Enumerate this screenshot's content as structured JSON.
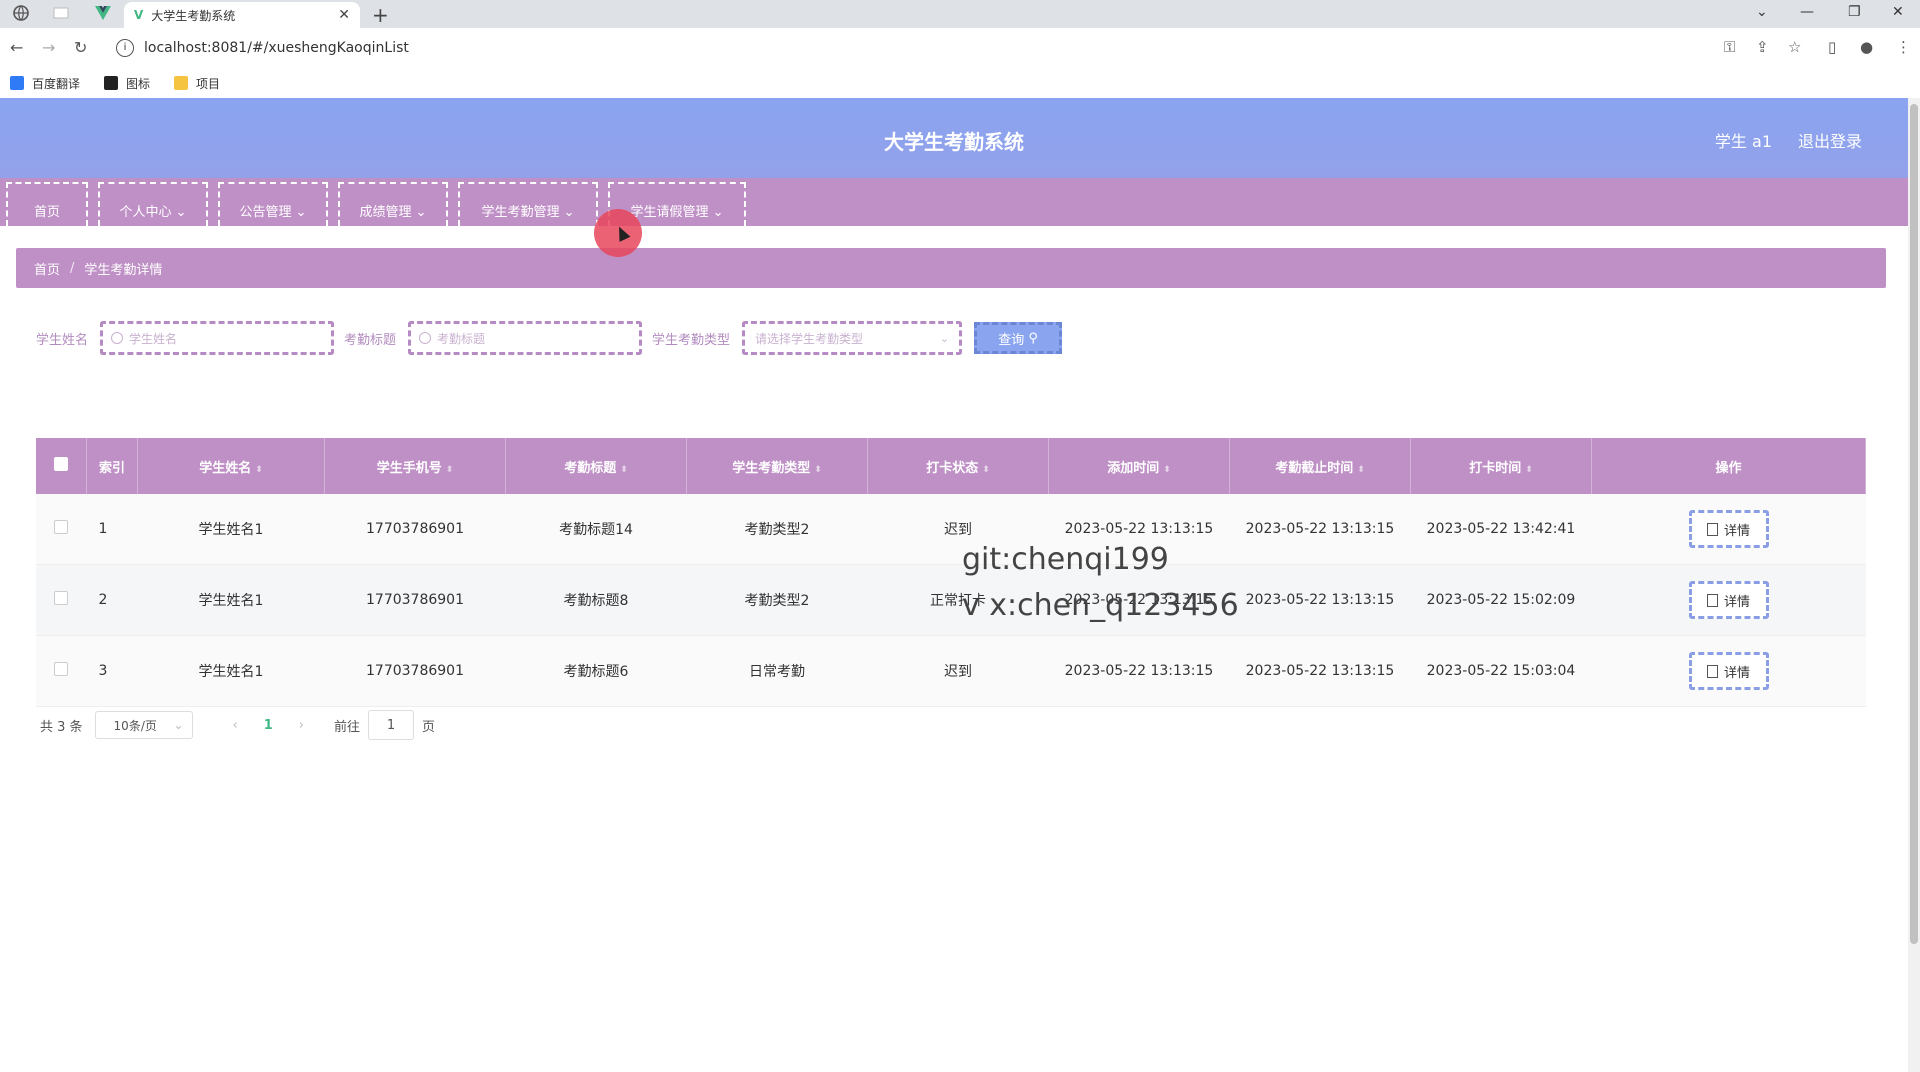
{
  "browser": {
    "tab_title": "大学生考勤系统",
    "url": "localhost:8081/#/xueshengKaoqinList",
    "bookmarks": [
      "百度翻译",
      "图标",
      "项目"
    ]
  },
  "app": {
    "title": "大学生考勤系统",
    "user": "学生 a1",
    "logout": "退出登录"
  },
  "menu": [
    "首页",
    "个人中心",
    "公告管理",
    "成绩管理",
    "学生考勤管理",
    "学生请假管理"
  ],
  "breadcrumb": [
    "首页",
    "学生考勤详情"
  ],
  "search": {
    "name_label": "学生姓名",
    "name_placeholder": "学生姓名",
    "title_label": "考勤标题",
    "title_placeholder": "考勤标题",
    "type_label": "学生考勤类型",
    "type_placeholder": "请选择学生考勤类型",
    "query_label": "查询"
  },
  "table": {
    "columns": [
      "索引",
      "学生姓名",
      "学生手机号",
      "考勤标题",
      "学生考勤类型",
      "打卡状态",
      "添加时间",
      "考勤截止时间",
      "打卡时间",
      "操作"
    ],
    "rows": [
      [
        "1",
        "学生姓名1",
        "17703786901",
        "考勤标题14",
        "考勤类型2",
        "迟到",
        "2023-05-22 13:13:15",
        "2023-05-22 13:13:15",
        "2023-05-22 13:42:41"
      ],
      [
        "2",
        "学生姓名1",
        "17703786901",
        "考勤标题8",
        "考勤类型2",
        "正常打卡",
        "2023-05-22 13:13:15",
        "2023-05-22 13:13:15",
        "2023-05-22 15:02:09"
      ],
      [
        "3",
        "学生姓名1",
        "17703786901",
        "考勤标题6",
        "日常考勤",
        "迟到",
        "2023-05-22 13:13:15",
        "2023-05-22 13:13:15",
        "2023-05-22 15:03:04"
      ]
    ],
    "action_label": "详情"
  },
  "pager": {
    "total": "共 3 条",
    "page_size": "10条/页",
    "current_page": "1",
    "goto_prefix": "前往",
    "goto_value": "1",
    "goto_suffix": "页"
  },
  "watermark": [
    "git:chenqi199",
    "v x:chen_q123456"
  ],
  "colors": {
    "header": "#8aa4f0",
    "menu": "#bf90c6",
    "accent": "#41b883"
  }
}
